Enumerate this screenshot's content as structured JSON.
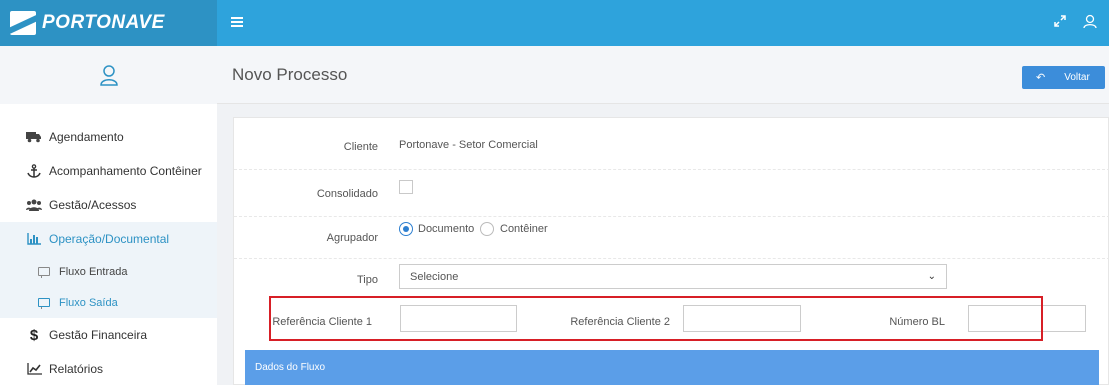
{
  "app": {
    "brand": "PORTONAVE"
  },
  "sidebar": {
    "items": [
      {
        "label": "Agendamento",
        "icon": "truck-icon"
      },
      {
        "label": "Acompanhamento Contêiner",
        "icon": "anchor-icon"
      },
      {
        "label": "Gestão/Acessos",
        "icon": "users-icon"
      },
      {
        "label": "Operação/Documental",
        "icon": "bar-chart-icon"
      },
      {
        "label": "Gestão Financeira",
        "icon": "dollar-icon"
      },
      {
        "label": "Relatórios",
        "icon": "line-chart-icon"
      }
    ],
    "subitems": [
      {
        "label": "Fluxo Entrada"
      },
      {
        "label": "Fluxo Saída"
      }
    ]
  },
  "header": {
    "title": "Novo Processo",
    "back_label": "Voltar"
  },
  "form": {
    "cliente_label": "Cliente",
    "cliente_value": "Portonave - Setor Comercial",
    "consolidado_label": "Consolidado",
    "agrupador_label": "Agrupador",
    "agrupador_options": [
      "Documento",
      "Contêiner"
    ],
    "agrupador_selected": "Documento",
    "tipo_label": "Tipo",
    "tipo_value": "Selecione",
    "ref1_label": "Referência Cliente 1",
    "ref2_label": "Referência Cliente 2",
    "numero_bl_label": "Número BL"
  },
  "section": {
    "dados_fluxo": "Dados do Fluxo"
  },
  "colors": {
    "topbar": "#2ea3dc",
    "accent": "#3c8dda",
    "highlight": "#d71f26"
  }
}
